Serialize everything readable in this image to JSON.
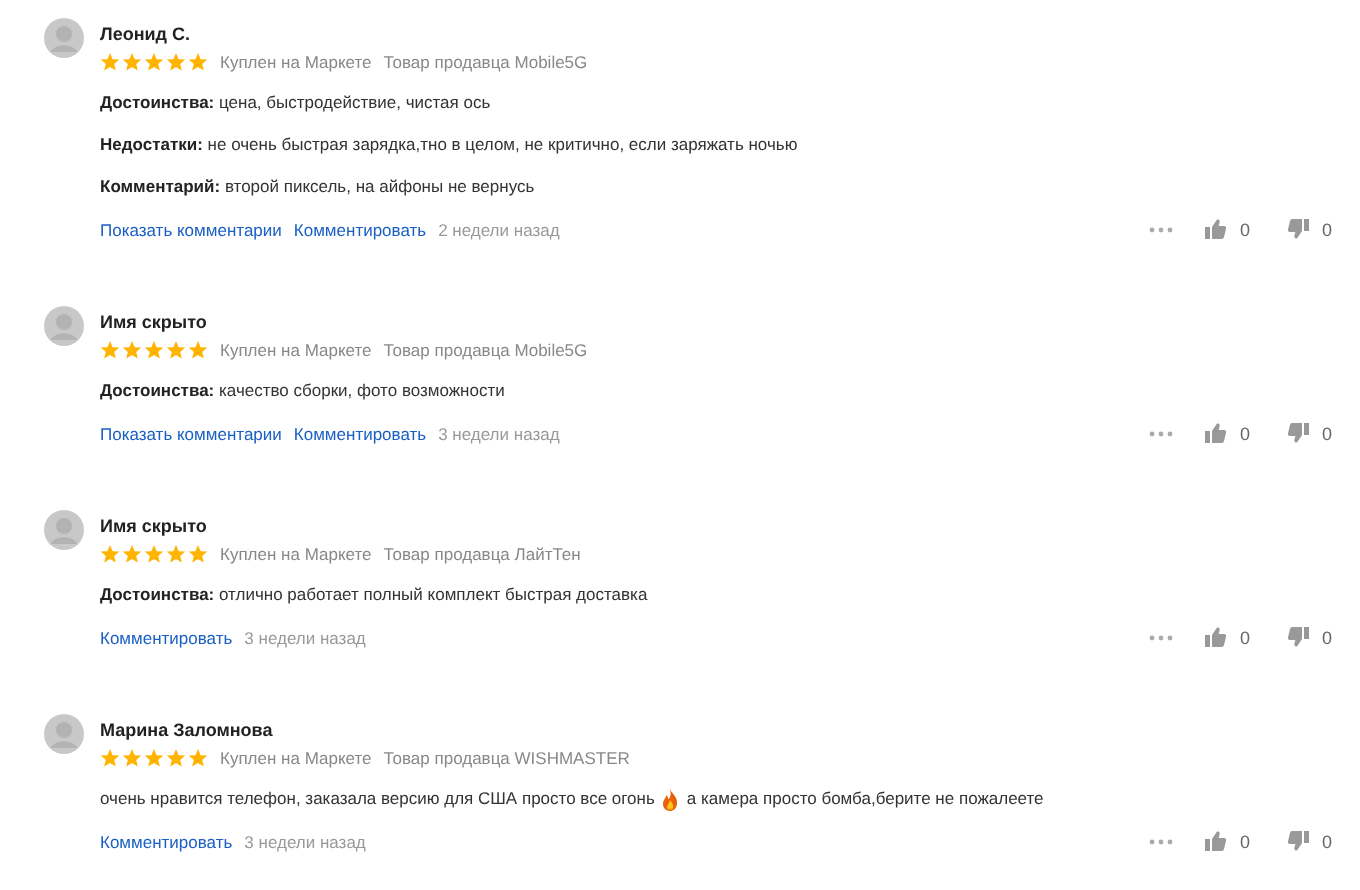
{
  "reviews": [
    {
      "author": "Леонид С.",
      "stars": 5,
      "badges": [
        "Куплен на Маркете",
        "Товар продавца Mobile5G"
      ],
      "fields": [
        "**Достоинства:** цена, быстродействие, чистая ось",
        "**Недостатки:** не очень быстрая зарядка,тно в целом, не критично, если заряжать ночью",
        "**Комментарий:** второй пиксель, на айфоны не вернусь"
      ],
      "links": [
        "Показать комментарии",
        "Комментировать"
      ],
      "date": "2 недели назад",
      "likes": "0",
      "dislikes": "0"
    },
    {
      "author": "Имя скрыто",
      "stars": 5,
      "badges": [
        "Куплен на Маркете",
        "Товар продавца Mobile5G"
      ],
      "fields": [
        "**Достоинства:** качество сборки, фото возможности"
      ],
      "links": [
        "Показать комментарии",
        "Комментировать"
      ],
      "date": "3 недели назад",
      "likes": "0",
      "dislikes": "0"
    },
    {
      "author": "Имя скрыто",
      "stars": 5,
      "badges": [
        "Куплен на Маркете",
        "Товар продавца ЛайтТен"
      ],
      "fields": [
        "**Достоинства:** отлично работает полный комплект быстрая доставка"
      ],
      "links": [
        "Комментировать"
      ],
      "date": "3 недели назад",
      "likes": "0",
      "dislikes": "0"
    },
    {
      "author": "Марина Заломнова",
      "stars": 5,
      "badges": [
        "Куплен на Маркете",
        "Товар продавца WISHMASTER"
      ],
      "text": "очень нравится телефон, заказала версию для США просто все огонь",
      "fire_mark": true,
      "text_after": "а камера просто бомба,берите не пожалеете",
      "links": [
        "Комментировать"
      ],
      "date": "3 недели назад",
      "likes": "0",
      "dislikes": "0"
    }
  ]
}
